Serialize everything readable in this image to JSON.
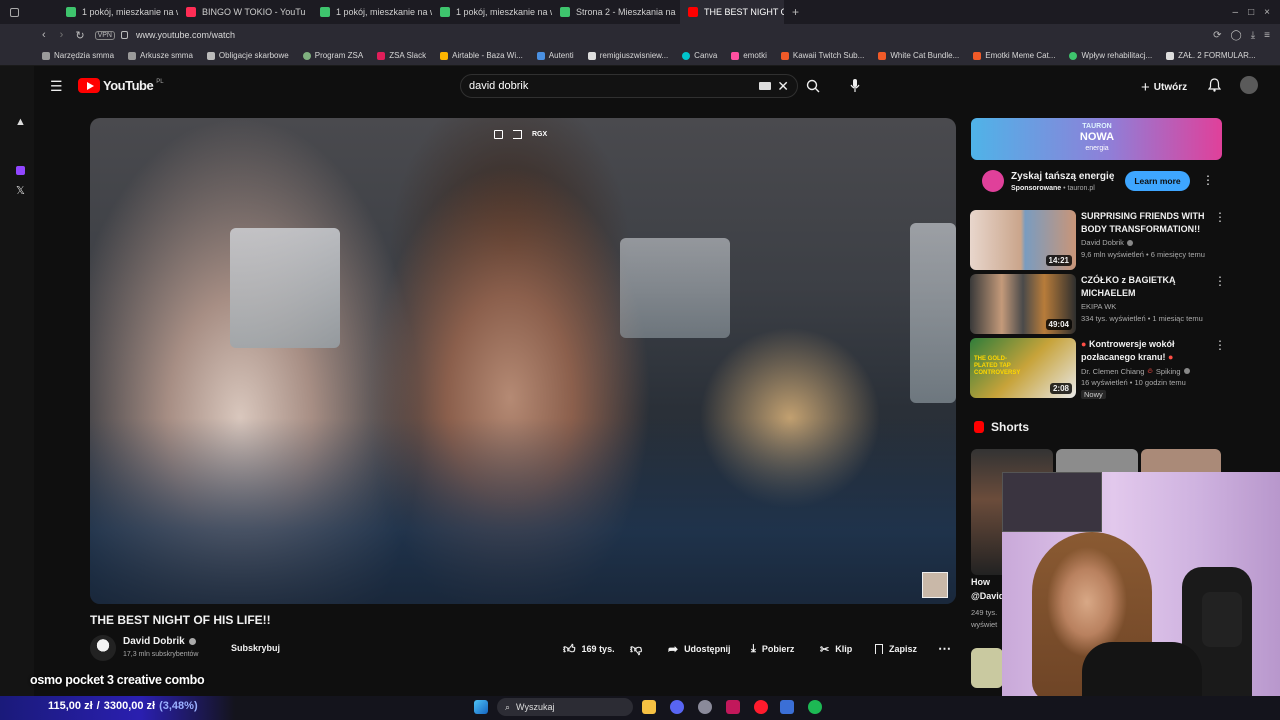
{
  "browser": {
    "tabs": [
      {
        "label": "1 pokój, mieszkanie na w",
        "color": "#3ec46d",
        "active": false
      },
      {
        "label": "BINGO W TOKIO - YouTu",
        "color": "#ff2d55",
        "active": false
      },
      {
        "label": "1 pokój, mieszkanie na w",
        "color": "#3ec46d",
        "active": false
      },
      {
        "label": "1 pokój, mieszkanie na w",
        "color": "#3ec46d",
        "active": false
      },
      {
        "label": "Strona 2 - Mieszkania na",
        "color": "#3ec46d",
        "active": false
      },
      {
        "label": "THE BEST NIGHT OF",
        "color": "#ff0000",
        "active": true
      }
    ],
    "vpn_badge": "VPN",
    "url": "www.youtube.com/watch",
    "bookmarks": [
      {
        "label": "Narzędzia smma",
        "color": "#9a9a9a"
      },
      {
        "label": "Arkusze smma",
        "color": "#9a9a9a"
      },
      {
        "label": "Obligacje skarbowe",
        "color": "#bbbbbb"
      },
      {
        "label": "Program ZSA",
        "color": "#7fb07f"
      },
      {
        "label": "ZSA Slack",
        "color": "#e01e5a"
      },
      {
        "label": "Airtable - Baza Wi...",
        "color": "#fcb400"
      },
      {
        "label": "Autenti",
        "color": "#4a90e2"
      },
      {
        "label": "remigiuszwisniew...",
        "color": "#dddddd"
      },
      {
        "label": "Canva",
        "color": "#00c4cc"
      },
      {
        "label": "emotki",
        "color": "#ff4fa0"
      },
      {
        "label": "Kawaii Twitch Sub...",
        "color": "#f05a28"
      },
      {
        "label": "White Cat Bundle...",
        "color": "#f05a28"
      },
      {
        "label": "Emotki Meme Cat...",
        "color": "#f05a28"
      },
      {
        "label": "Wpływ rehabilitacj...",
        "color": "#3ec46d"
      },
      {
        "label": "ZAŁ. 2 FORMULAR...",
        "color": "#dddddd"
      }
    ]
  },
  "youtube": {
    "logo": "YouTube",
    "logo_region": "PL",
    "search_value": "david dobrik",
    "create_label": "Utwórz"
  },
  "video": {
    "overlay_label": "RGX",
    "title": "THE BEST NIGHT OF HIS LIFE!!",
    "channel": "David Dobrik",
    "subscribers": "17,3 mln subskrybentów",
    "subscribe_label": "Subskrybuj",
    "likes": "169 tys.",
    "share_label": "Udostępnij",
    "download_label": "Pobierz",
    "clip_label": "Klip",
    "save_label": "Zapisz"
  },
  "ad": {
    "banner_line1": "TAURON",
    "banner_line2": "NOWA",
    "banner_line3": "energia",
    "title": "Zyskaj tańszą energię",
    "sponsored": "Sponsorowane",
    "domain": "tauron.pl",
    "cta": "Learn more"
  },
  "related": [
    {
      "title": "SURPRISING FRIENDS WITH BODY TRANSFORMATION!!",
      "channel": "David Dobrik",
      "verified": true,
      "meta": "9,6 mln wyświetleń • 6 miesięcy temu",
      "duration": "14:21",
      "badge": ""
    },
    {
      "title": "CZÓŁKO z BAGIETKĄ MICHAELEM",
      "channel": "EKIPA WK",
      "verified": false,
      "meta": "334 tys. wyświetleń • 1 miesiąc temu",
      "duration": "49:04",
      "badge": ""
    },
    {
      "title": "Kontrowersje wokół pozłacanego kranu!",
      "channel": "Dr. Clemen Chiang",
      "verified": true,
      "meta": "16 wyświetleń • 10 godzin temu",
      "duration": "2:08",
      "badge": "Nowy",
      "channel_suffix": "Spiking",
      "thumb_text": "THE GOLD-PLATED TAP CONTROVERSY"
    }
  ],
  "shorts": {
    "heading": "Shorts",
    "partial_title": "How",
    "partial_title2": "@David",
    "partial_views": "249 tys.",
    "partial_views2": "wyświet"
  },
  "stream_overlay": {
    "osmo_text": "osmo pocket 3 creative combo",
    "money_current": "115,00 zł",
    "money_sep": "/",
    "money_goal": "3300,00 zł",
    "money_pct": "(3,48%)"
  },
  "taskbar": {
    "search_placeholder": "Wyszukaj"
  },
  "colors": {
    "yt_red": "#ff0000",
    "learn_more": "#3ea6ff",
    "bg": "#0f0f0f",
    "ad_gradient_start": "#4fb3e8",
    "ad_gradient_end": "#e0409a"
  }
}
